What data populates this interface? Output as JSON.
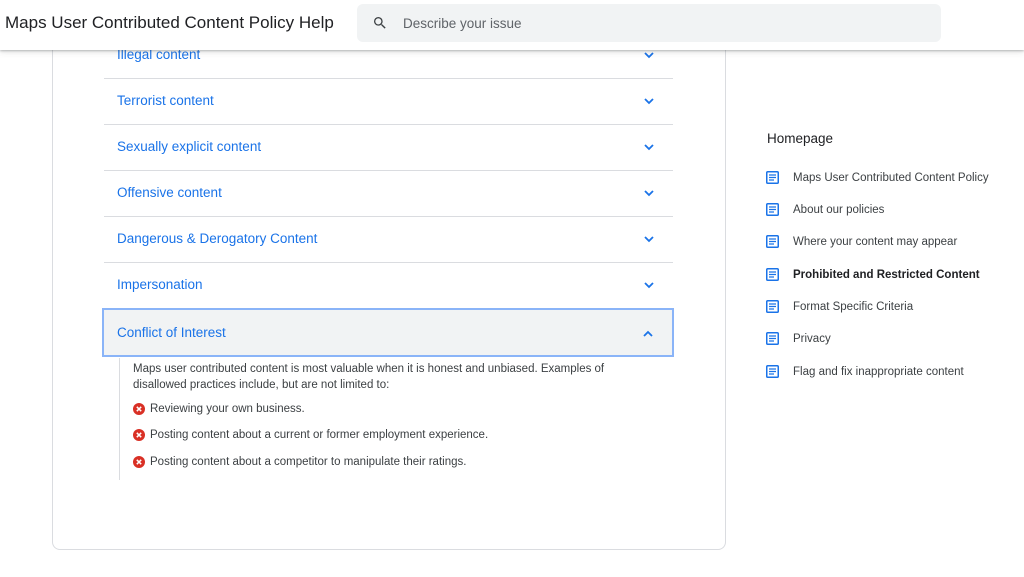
{
  "header": {
    "title": "Maps User Contributed Content Policy Help",
    "search_placeholder": "Describe your issue"
  },
  "accordion": {
    "items": [
      {
        "label": "Illegal content"
      },
      {
        "label": "Terrorist content"
      },
      {
        "label": "Sexually explicit content"
      },
      {
        "label": "Offensive content"
      },
      {
        "label": "Dangerous & Derogatory Content"
      },
      {
        "label": "Impersonation"
      }
    ],
    "expanded": {
      "label": "Conflict of Interest",
      "intro": "Maps user contributed content is most valuable when it is honest and unbiased. Examples of disallowed practices include, but are not limited to:",
      "bullets": [
        "Reviewing your own business.",
        "Posting content about a current or former employment experience.",
        "Posting content about a competitor to manipulate their ratings."
      ]
    }
  },
  "sidebar": {
    "title": "Homepage",
    "items": [
      {
        "label": "Maps User Contributed Content Policy"
      },
      {
        "label": "About our policies"
      },
      {
        "label": "Where your content may appear"
      },
      {
        "label": "Prohibited and Restricted Content"
      },
      {
        "label": "Format Specific Criteria"
      },
      {
        "label": "Privacy"
      },
      {
        "label": "Flag and fix inappropriate content"
      }
    ]
  },
  "colors": {
    "link": "#1a73e8",
    "error": "#d93025",
    "focus_border": "#8ab4f8"
  }
}
